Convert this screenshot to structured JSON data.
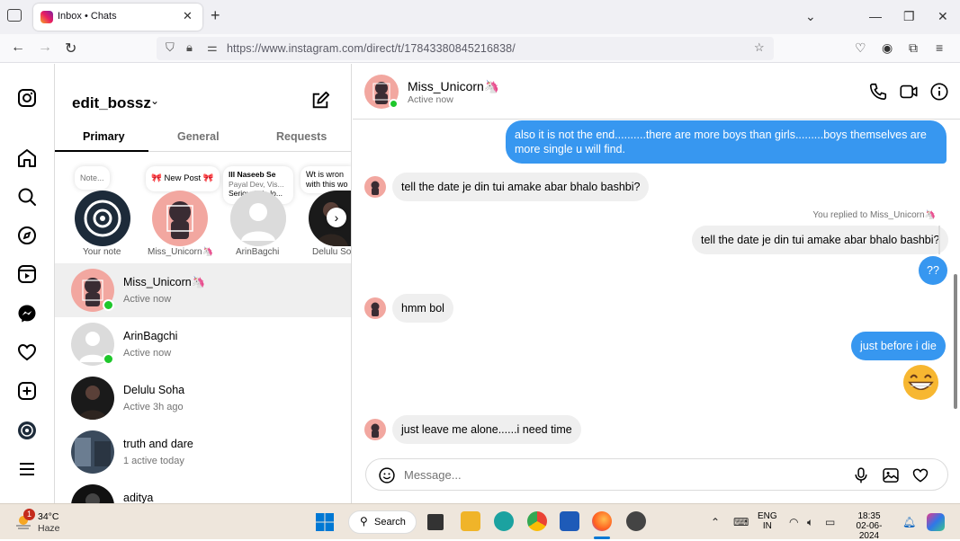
{
  "browser": {
    "tab_title": "Inbox • Chats",
    "url": "https://www.instagram.com/direct/t/17843380845216838/"
  },
  "inbox": {
    "username": "edit_bossz",
    "tabs": [
      "Primary",
      "General",
      "Requests"
    ],
    "notes": [
      {
        "bubble": "Note...",
        "name": "Your note"
      },
      {
        "bubble": "🎀 New Post 🎀",
        "name": "Miss_Unicorn🦄"
      },
      {
        "bubble_title": "lll Naseeb Se",
        "bubble_sub": "Payal Dev, Vis...",
        "bubble_text": "Seriously in lo...",
        "name": "ArinBagchi"
      },
      {
        "bubble_line1": "Wt is wron",
        "bubble_line2": "with this wo",
        "name": "Delulu Soh"
      }
    ],
    "chats": [
      {
        "name": "Miss_Unicorn🦄",
        "status": "Active now"
      },
      {
        "name": "ArinBagchi",
        "status": "Active now"
      },
      {
        "name": "Delulu Soha",
        "status": "Active 3h ago"
      },
      {
        "name": "truth and dare",
        "status": "1 active today"
      },
      {
        "name": "aditya",
        "status": ""
      }
    ]
  },
  "conversation": {
    "name": "Miss_Unicorn🦄",
    "status": "Active now",
    "messages": [
      {
        "dir": "out",
        "text": "also it is not the end..........there are more boys than girls.........boys themselves are more single u will find."
      },
      {
        "dir": "in",
        "text": "tell the date je din tui amake abar bhalo bashbi?"
      },
      {
        "dir": "meta",
        "text": "You replied to Miss_Unicorn🦄"
      },
      {
        "dir": "in",
        "text": "tell the date je din tui amake abar bhalo bashbi?"
      },
      {
        "dir": "out",
        "text": "??"
      },
      {
        "dir": "in",
        "text": "hmm bol"
      },
      {
        "dir": "out",
        "text": "just before i die"
      },
      {
        "dir": "out",
        "text": "😁"
      },
      {
        "dir": "in",
        "text": "just leave me alone......i need time"
      }
    ],
    "composer_placeholder": "Message..."
  },
  "taskbar": {
    "weather_badge": "1",
    "temperature": "34°C",
    "condition": "Haze",
    "search_label": "Search",
    "lang_line1": "ENG",
    "lang_line2": "IN",
    "time": "18:35",
    "date": "02-06-2024"
  },
  "colors": {
    "accent": "#3797f0",
    "online": "#1ec72b",
    "incoming_bubble": "#efefef"
  }
}
